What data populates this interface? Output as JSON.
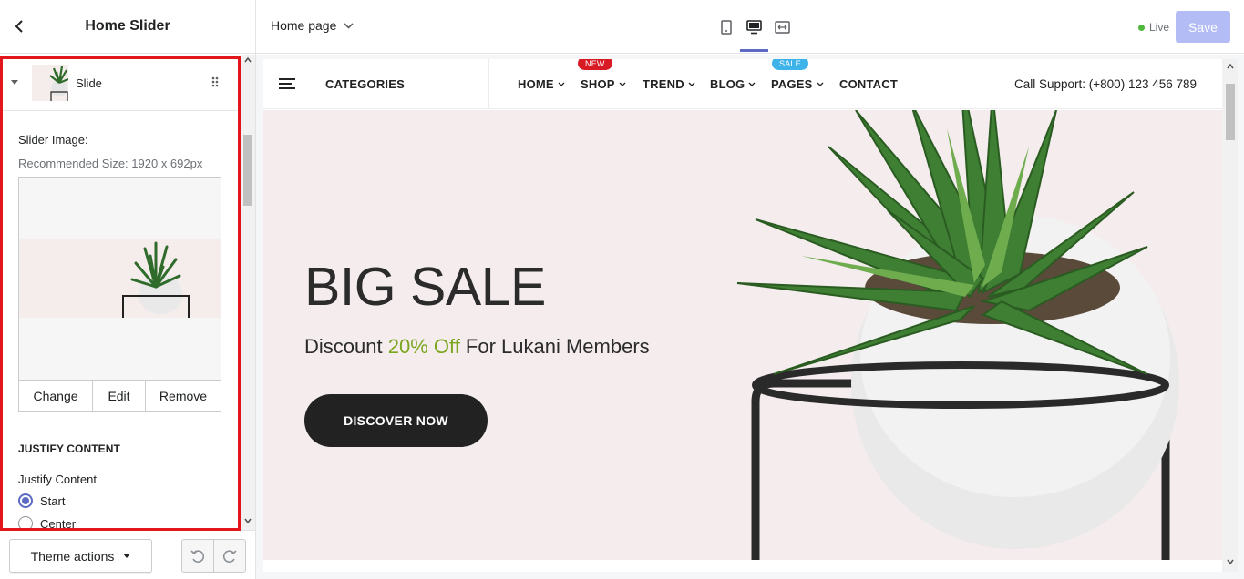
{
  "sidebar": {
    "title": "Home Slider",
    "block": {
      "label": "Slide"
    },
    "image_field": {
      "label": "Slider Image:",
      "hint": "Recommended Size: 1920 x 692px",
      "change_label": "Change",
      "edit_label": "Edit",
      "remove_label": "Remove"
    },
    "justify": {
      "heading": "JUSTIFY CONTENT",
      "label": "Justify Content",
      "options": [
        {
          "label": "Start",
          "checked": true
        },
        {
          "label": "Center",
          "checked": false
        }
      ]
    },
    "footer": {
      "theme_actions_label": "Theme actions"
    }
  },
  "topbar": {
    "page_select_label": "Home page",
    "live_label": "Live",
    "save_label": "Save"
  },
  "store": {
    "categories_label": "CATEGORIES",
    "nav": [
      {
        "label": "HOME",
        "badge": null
      },
      {
        "label": "SHOP",
        "badge": "NEW"
      },
      {
        "label": "TREND",
        "badge": null
      },
      {
        "label": "BLOG",
        "badge": null
      },
      {
        "label": "PAGES",
        "badge": "SALE"
      },
      {
        "label": "CONTACT",
        "badge": null
      }
    ],
    "support": "Call Support: (+800) 123 456 789",
    "hero": {
      "title": "BIG SALE",
      "sub_before": "Discount ",
      "sub_accent": "20% Off",
      "sub_after": " For Lukani Members",
      "button_label": "DISCOVER NOW"
    }
  },
  "colors": {
    "highlight_border": "#e3161c",
    "accent_purple": "#5c6ac4",
    "save_disabled": "#b3bcf5",
    "live_green": "#50b83c",
    "badge_new": "#d71a24",
    "badge_sale": "#3db3ea",
    "hero_bg": "#f5eced",
    "hero_accent": "#7aa61d",
    "hero_button": "#222222"
  },
  "icons": {
    "back": "chevron-left-icon",
    "caret": "caret-down-icon",
    "drag": "drag-handle-icon",
    "devices": [
      "mobile-icon",
      "desktop-icon",
      "fullwidth-icon"
    ],
    "undo": "undo-icon",
    "redo": "redo-icon",
    "menu": "hamburger-icon"
  }
}
